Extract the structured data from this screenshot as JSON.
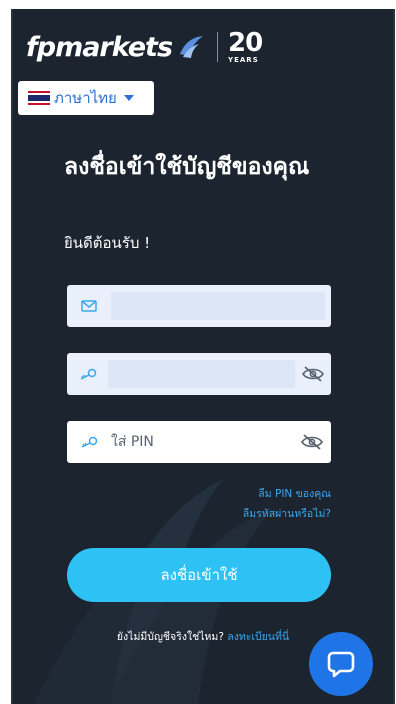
{
  "brand": {
    "name": "fpmarkets",
    "years_number": "20",
    "years_label": "YEARS"
  },
  "language": {
    "selected": "ภาษาไทย"
  },
  "heading": {
    "title": "ลงชื่อเข้าใช้บัญชีของคุณ",
    "welcome": "ยินดีต้อนรับ !"
  },
  "form": {
    "email_value": "",
    "password_value": "",
    "pin_placeholder": "ใส่ PIN"
  },
  "links": {
    "forgot_pin": "ลืม PIN ของคุณ",
    "forgot_password": "ลืมรหัสผ่านหรือไม่?"
  },
  "login_button": "ลงชื่อเข้าใช้",
  "signup": {
    "prompt": "ยังไม่มีบัญชีจริงใช่ไหม?",
    "link": "ลงทะเบียนที่นี่"
  },
  "colors": {
    "background": "#1c2430",
    "accent": "#2ec1f3",
    "link": "#3aa8f0",
    "chat": "#1f74e8"
  },
  "icons": [
    "mail-icon",
    "key-icon",
    "eye-off-icon",
    "chevron-down-icon",
    "chat-icon",
    "thailand-flag-icon"
  ]
}
